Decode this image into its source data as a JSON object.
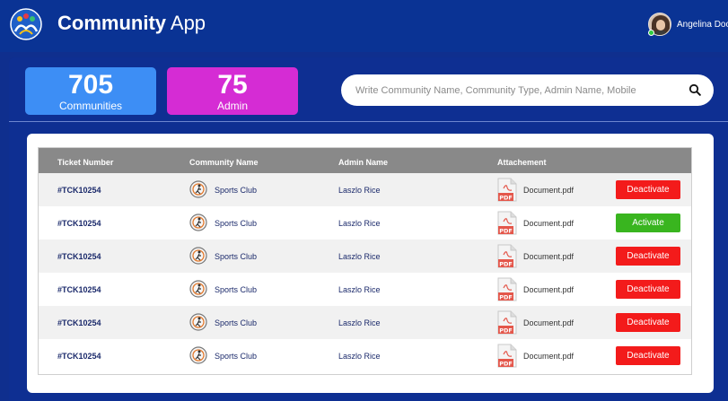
{
  "header": {
    "title_bold": "Community",
    "title_light": " App",
    "user_name": "Angelina Doo"
  },
  "stats": {
    "communities_count": "705",
    "communities_label": "Communities",
    "admin_count": "75",
    "admin_label": "Admin"
  },
  "search": {
    "placeholder": "Write Community Name, Community Type, Admin Name, Mobile"
  },
  "table": {
    "columns": [
      "Ticket Number",
      "Community Name",
      "Admin Name",
      "Attachement"
    ],
    "rows": [
      {
        "ticket": "#TCK10254",
        "community": "Sports Club",
        "admin": "Laszlo Rice",
        "document": "Document.pdf",
        "action": "Deactivate"
      },
      {
        "ticket": "#TCK10254",
        "community": "Sports Club",
        "admin": "Laszlo Rice",
        "document": "Document.pdf",
        "action": "Activate"
      },
      {
        "ticket": "#TCK10254",
        "community": "Sports Club",
        "admin": "Laszlo Rice",
        "document": "Document.pdf",
        "action": "Deactivate"
      },
      {
        "ticket": "#TCK10254",
        "community": "Sports Club",
        "admin": "Laszlo Rice",
        "document": "Document.pdf",
        "action": "Deactivate"
      },
      {
        "ticket": "#TCK10254",
        "community": "Sports Club",
        "admin": "Laszlo Rice",
        "document": "Document.pdf",
        "action": "Deactivate"
      },
      {
        "ticket": "#TCK10254",
        "community": "Sports Club",
        "admin": "Laszlo Rice",
        "document": "Document.pdf",
        "action": "Deactivate"
      }
    ]
  },
  "colors": {
    "background": "#0f2f8e",
    "communities_card": "#3d8ef5",
    "admin_card": "#d52cd4",
    "deactivate": "#f31b1b",
    "activate": "#39b51f",
    "table_header": "#898989"
  },
  "icons": {
    "logo": "community-logo-icon",
    "search": "search-icon",
    "community": "sports-club-icon",
    "attachment": "pdf-icon"
  }
}
